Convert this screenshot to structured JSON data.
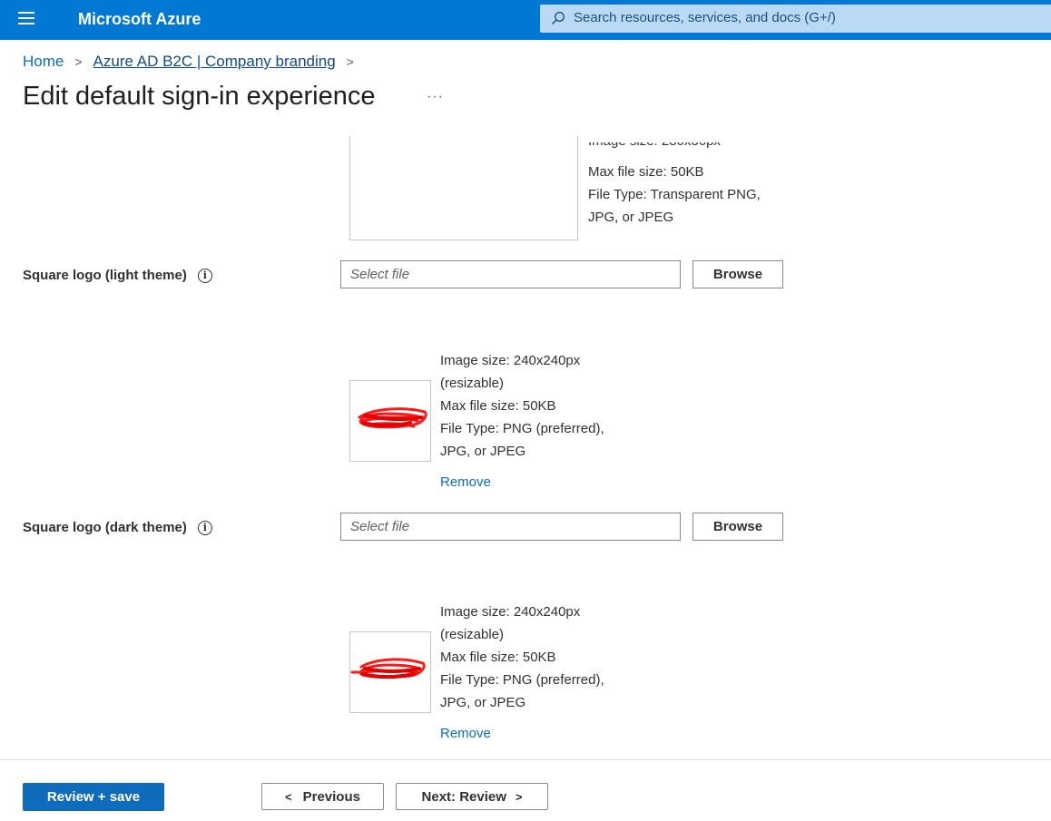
{
  "topbar": {
    "brand": "Microsoft Azure",
    "search_placeholder": "Search resources, services, and docs (G+/)",
    "color": "#0078d4"
  },
  "breadcrumb": {
    "home": "Home",
    "current": "Azure AD B2C | Company branding"
  },
  "page": {
    "title": "Edit default sign-in experience",
    "more": "···"
  },
  "banner_logo": {
    "info": [
      "Max file size: 50KB",
      "File Type: Transparent PNG,",
      "JPG, or JPEG"
    ]
  },
  "square_light": {
    "label": "Square logo (light theme)",
    "file_placeholder": "Select file",
    "browse": "Browse",
    "info": [
      "Image size: 240x240px",
      "(resizable)",
      "Max file size: 50KB",
      "File Type: PNG (preferred),",
      "JPG, or JPEG"
    ],
    "remove": "Remove"
  },
  "square_dark": {
    "label": "Square logo (dark theme)",
    "file_placeholder": "Select file",
    "browse": "Browse",
    "info": [
      "Image size: 240x240px",
      "(resizable)",
      "Max file size: 50KB",
      "File Type: PNG (preferred),",
      "JPG, or JPEG"
    ],
    "remove": "Remove"
  },
  "footer": {
    "review_save": "Review + save",
    "previous": "Previous",
    "next": "Next: Review"
  }
}
